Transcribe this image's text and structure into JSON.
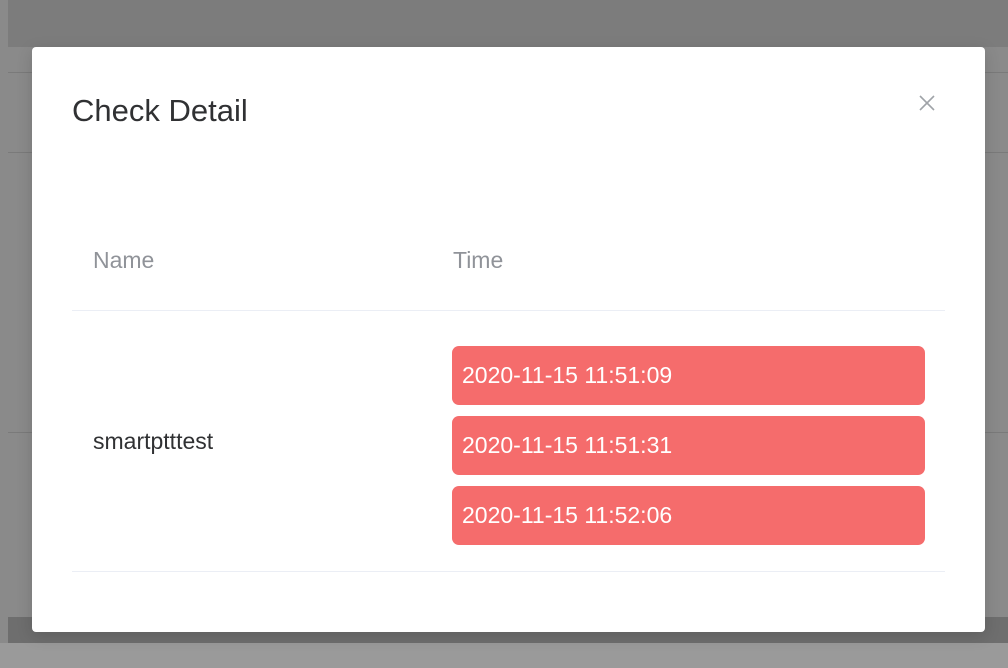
{
  "dialog": {
    "title": "Check Detail",
    "close_icon": "close-icon"
  },
  "table": {
    "columns": [
      "Name",
      "Time"
    ],
    "rows": [
      {
        "name": "smartptttest",
        "times": [
          "2020-11-15 11:51:09",
          "2020-11-15 11:51:31",
          "2020-11-15 11:52:06"
        ]
      }
    ]
  },
  "colors": {
    "overlay": "#8a8a8a",
    "tag_background": "#f56c6c",
    "tag_text": "#ffffff",
    "header_text": "#909399",
    "body_text": "#303133"
  }
}
